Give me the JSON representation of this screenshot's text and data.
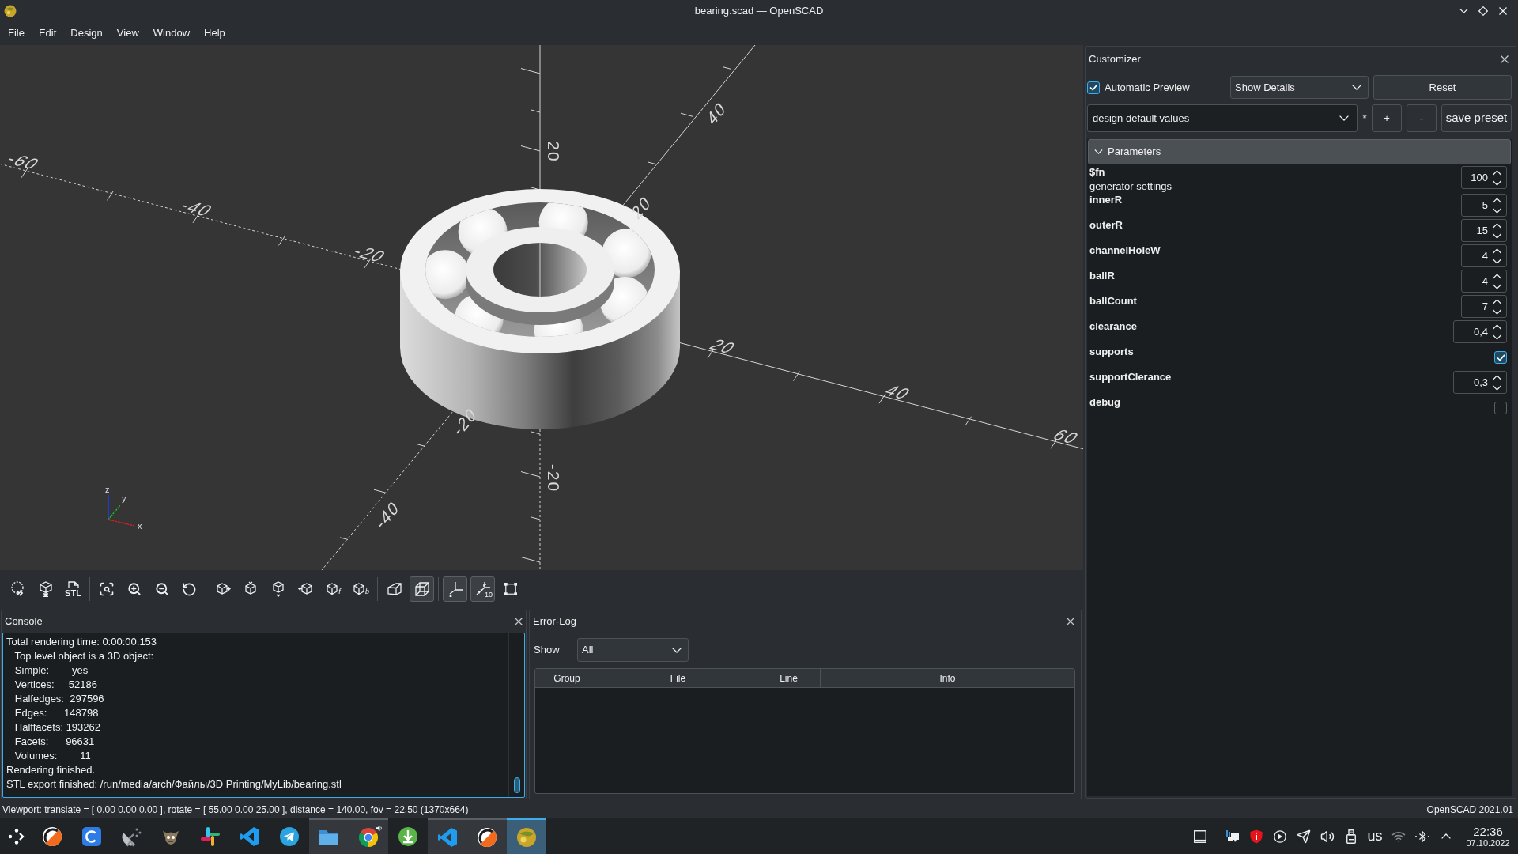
{
  "window": {
    "title": "bearing.scad — OpenSCAD"
  },
  "menu": [
    "File",
    "Edit",
    "Design",
    "View",
    "Window",
    "Help"
  ],
  "viewport": {
    "x_axis_labels": [
      "-60",
      "-40",
      "-20",
      "20",
      "40",
      "60"
    ],
    "y_axis_labels": [
      "40",
      "20",
      "-20",
      "-40"
    ],
    "z_axis_labels": [
      "20",
      "-20"
    ],
    "gizmo_labels": [
      "z",
      "y",
      "x"
    ]
  },
  "toolbar": {
    "groups": [
      [
        {
          "on": false
        },
        {
          "on": false
        },
        {
          "on": false,
          "label": "STL"
        }
      ],
      [
        {
          "on": false
        },
        {
          "on": false
        },
        {
          "on": false
        },
        {
          "on": false
        }
      ],
      [
        {
          "on": false
        },
        {
          "on": false
        },
        {
          "on": false
        },
        {
          "on": false
        },
        {
          "on": false,
          "label": "f"
        },
        {
          "on": false,
          "label": "b"
        }
      ],
      [
        {
          "on": false
        },
        {
          "on": true
        }
      ],
      [
        {
          "on": true
        },
        {
          "on": true,
          "label": "10"
        },
        {
          "on": false
        }
      ]
    ]
  },
  "console": {
    "title": "Console",
    "lines": [
      "Total rendering time: 0:00:00.153",
      "   Top level object is a 3D object:",
      "   Simple:        yes",
      "   Vertices:     52186",
      "   Halfedges:  297596",
      "   Edges:      148798",
      "   Halffacets: 193262",
      "   Facets:      96631",
      "   Volumes:        11",
      "Rendering finished.",
      "STL export finished: /run/media/arch/Файлы/3D Printing/MyLib/bearing.stl"
    ]
  },
  "error_log": {
    "title": "Error-Log",
    "filter_label": "Show",
    "filter": {
      "value": "All"
    },
    "columns": [
      "Group",
      "File",
      "Line",
      "Info"
    ]
  },
  "customizer": {
    "title": "Customizer",
    "automatic_preview": {
      "label": "Automatic Preview",
      "checked": true
    },
    "details": {
      "value": "Show Details"
    },
    "reset": "Reset",
    "preset": {
      "value": "design default values"
    },
    "modified_mark": "*",
    "preset_buttons": [
      "+",
      "-",
      "save preset"
    ],
    "section": {
      "title": "Parameters",
      "expanded": true
    },
    "parameters": [
      {
        "kind": "int",
        "name": "$fn",
        "description": "generator settings",
        "value": "100"
      },
      {
        "kind": "int",
        "name": "innerR",
        "value": "5"
      },
      {
        "kind": "int",
        "name": "outerR",
        "value": "15"
      },
      {
        "kind": "int",
        "name": "channelHoleW",
        "value": "4"
      },
      {
        "kind": "int",
        "name": "ballR",
        "value": "4"
      },
      {
        "kind": "int",
        "name": "ballCount",
        "value": "7"
      },
      {
        "kind": "float",
        "name": "clearance",
        "value": "0,4"
      },
      {
        "kind": "bool",
        "name": "supports",
        "checked": true
      },
      {
        "kind": "float",
        "name": "supportClerance",
        "value": "0,3"
      },
      {
        "kind": "bool",
        "name": "debug",
        "checked": false
      }
    ]
  },
  "status_bar": {
    "viewport": "Viewport: translate = [ 0.00 0.00 0.00 ], rotate = [ 55.00 0.00 25.00 ], distance = 140.00, fov = 22.50 (1370x664)",
    "version": "OpenSCAD 2021.01"
  },
  "taskbar": {
    "apps": [
      {
        "open": false,
        "selected": false
      },
      {
        "open": false,
        "selected": false
      },
      {
        "open": false,
        "selected": false
      },
      {
        "open": false,
        "selected": false
      },
      {
        "open": false,
        "selected": false
      },
      {
        "open": false,
        "selected": false
      },
      {
        "open": false,
        "selected": false
      },
      {
        "open": true,
        "selected": false
      },
      {
        "open": true,
        "selected": false
      },
      {
        "open": false,
        "selected": false
      },
      {
        "open": true,
        "selected": false
      },
      {
        "open": true,
        "selected": false
      },
      {
        "open": true,
        "selected": true
      }
    ],
    "keyboard_layout": "us",
    "clock": {
      "time": "22:36",
      "date": "07.10.2022"
    }
  }
}
